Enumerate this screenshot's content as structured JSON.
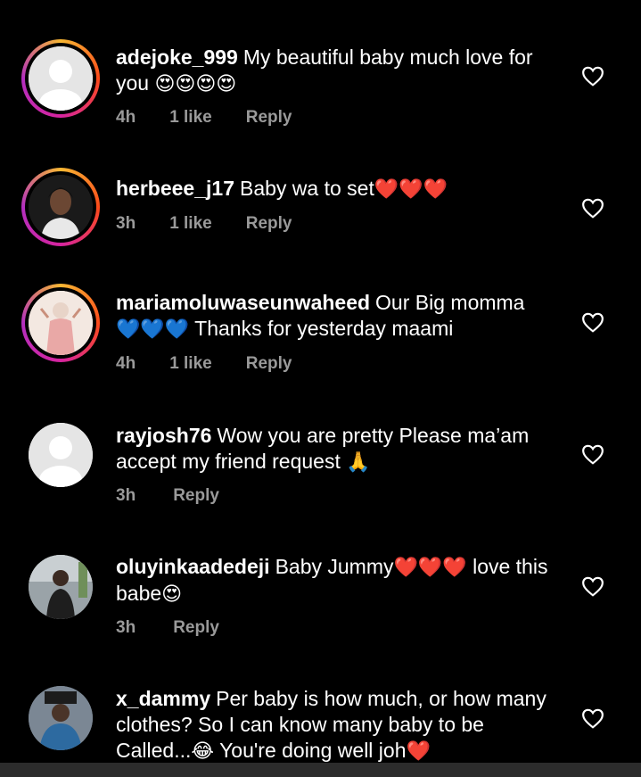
{
  "comments": [
    {
      "username": "adejoke_999",
      "text": "My beautiful baby much love for you",
      "emojis": "😍😍😍😍",
      "time": "4h",
      "likes": "1 like",
      "reply": "Reply"
    },
    {
      "username": "herbeee_j17",
      "text": "Baby wa to set",
      "emojis": "❤️❤️❤️",
      "time": "3h",
      "likes": "1 like",
      "reply": "Reply"
    },
    {
      "username": "mariamoluwaseunwaheed",
      "text": "Our Big momma",
      "emojis": "💙💙💙",
      "text2": "Thanks for yesterday maami",
      "time": "4h",
      "likes": "1 like",
      "reply": "Reply"
    },
    {
      "username": "rayjosh76",
      "text": "Wow you are pretty Please ma’am accept my friend request",
      "emojis": "🙏",
      "time": "3h",
      "reply": "Reply"
    },
    {
      "username": "oluyinkaadedeji",
      "text": "Baby Jummy",
      "emojis": "❤️❤️❤️",
      "text2": "love this babe",
      "emojis2": "😍",
      "time": "3h",
      "reply": "Reply"
    },
    {
      "username": "x_dammy",
      "text": "Per baby is how much, or how many clothes? So I can know many baby to be Called...",
      "emojis": "😂",
      "text2": "You're doing well joh",
      "emojis2": "❤️"
    }
  ],
  "icons": {
    "like": "heart-outline-icon",
    "avatar_placeholder": "default-avatar-icon"
  },
  "colors": {
    "background": "#000000",
    "meta": "#9a9a9a",
    "ring_start": "#f7b733",
    "ring_mid": "#d6249f"
  }
}
